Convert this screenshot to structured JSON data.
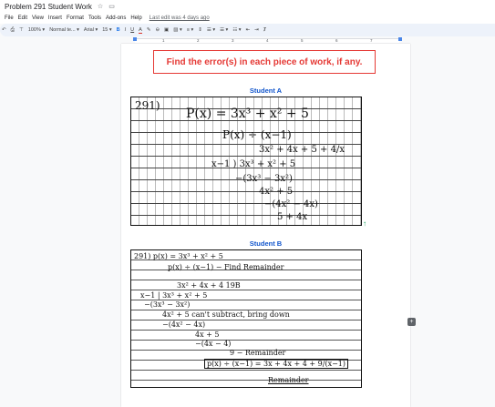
{
  "doc": {
    "title": "Problem 291 Student Work"
  },
  "menu": {
    "items": [
      "File",
      "Edit",
      "View",
      "Insert",
      "Format",
      "Tools",
      "Add-ons",
      "Help"
    ],
    "last_edit": "Last edit was 4 days ago"
  },
  "toolbar": {
    "zoom": "100%",
    "style": "Normal te...",
    "font": "Arial",
    "size": "15",
    "bold": "B",
    "italic": "I",
    "underline": "U",
    "text_color": "A"
  },
  "ruler": {
    "numbers": [
      "1",
      "2",
      "3",
      "4",
      "5",
      "6",
      "7"
    ]
  },
  "page": {
    "banner": "Find the error(s) in each piece of work, if any.",
    "student_a": {
      "label": "Student A",
      "lines": [
        "291)",
        "P(x) = 3x³ + x² + 5",
        "P(x) ÷ (x−1)",
        "3x² + 4x + 5 + 4/x",
        "x−1 ) 3x³ + x² + 5",
        "−(3x³ − 3x²)",
        "4x² + 5",
        "−(4x² − 4x)",
        "5 + 4x"
      ]
    },
    "student_b": {
      "label": "Student B",
      "lines": [
        "291) p(x) = 3x³ + x² + 5",
        "p(x) ÷ (x−1) − Find Remainder",
        "3x² + 4x + 4  19B",
        "x−1 | 3x³ + x² + 5",
        "−(3x³ − 3x²)",
        "4x² + 5  can't subtract, bring down",
        "−(4x² − 4x)",
        "4x + 5",
        "−(4x − 4)",
        "9 − Remainder",
        "p(x) ÷ (x−1) = 3x + 4x + 4 + 9/(x−1)",
        "Remainder"
      ]
    }
  },
  "colors": {
    "banner_red": "#e53935",
    "label_blue": "#1155cc",
    "accent_blue": "#1a73e8"
  }
}
